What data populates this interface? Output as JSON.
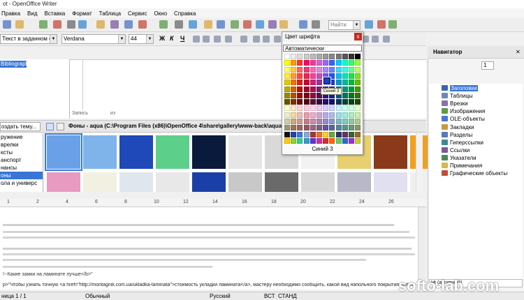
{
  "window": {
    "title": "ot - OpenOffice Writer"
  },
  "menu": [
    {
      "label": "Правка"
    },
    {
      "label": "Вид"
    },
    {
      "label": "Вставка"
    },
    {
      "label": "Формат"
    },
    {
      "label": "Таблица"
    },
    {
      "label": "Сервис"
    },
    {
      "label": "Окно"
    },
    {
      "label": "Справка"
    }
  ],
  "toolbar": {
    "find_placeholder": "Найти"
  },
  "format": {
    "style": "Текст в заданном фо",
    "font": "Verdana",
    "size": "44",
    "bold": "Ж",
    "italic": "К",
    "underline": "Ч"
  },
  "database": {
    "selected": "Bibliography",
    "records_label": "Запись",
    "of_label": "из"
  },
  "gallery": {
    "new_theme_label": "оздать тему...",
    "path_label": "Фоны - aqua (C:\\Program Files (x86)\\OpenOffice 4\\share\\gallery\\www-back\\aqua.jpg)",
    "themes": [
      {
        "label": "ружение"
      },
      {
        "label": "врелки"
      },
      {
        "label": "ксты"
      },
      {
        "label": "анспорт"
      },
      {
        "label": "нансы"
      },
      {
        "label": "оны"
      },
      {
        "label": "ола и универс"
      }
    ]
  },
  "ruler": {
    "ticks": [
      "1",
      "2",
      "4",
      "6",
      "8",
      "10",
      "12",
      "14",
      "16",
      "18",
      "20",
      "22",
      "24",
      "26"
    ]
  },
  "document": {
    "line_tag": "!--Какие замки на ламинате лучше</b>\"",
    "line_main": "р>\"Чтобы узнать точную <a href=\"http://montagnik.com.ua/ukladka-laminata\">стоимость укладки ламината</a>, мастеру необходимо сообщить, какой вид напольного покрытия выбра"
  },
  "color_popup": {
    "title": "Цвет шрифта",
    "close": "x",
    "automatic": "Автоматически",
    "selected_name": "Синий 3",
    "tooltip": "Синий 3"
  },
  "navigator": {
    "title": "Навигатор",
    "page_number": "1",
    "footer": "Ht (активный)",
    "items": [
      {
        "label": "Заголовки",
        "color": "#3c64b4"
      },
      {
        "label": "Таблицы",
        "color": "#6a8bb8"
      },
      {
        "label": "Врезки",
        "color": "#8b6fb0"
      },
      {
        "label": "Изображения",
        "color": "#5a9a4a"
      },
      {
        "label": "OLE-объекты",
        "color": "#4a78c8"
      },
      {
        "label": "Закладки",
        "color": "#c89a3a"
      },
      {
        "label": "Разделы",
        "color": "#5a7ab0"
      },
      {
        "label": "Гиперссылки",
        "color": "#3a8a9a"
      },
      {
        "label": "Ссылки",
        "color": "#7a5aa0"
      },
      {
        "label": "Указатели",
        "color": "#4a8a5a"
      },
      {
        "label": "Примечания",
        "color": "#d4b84a"
      },
      {
        "label": "Графические объекты",
        "color": "#c84a3a"
      }
    ]
  },
  "status": {
    "page": "ница  1 / 1",
    "style": "Обычный",
    "language": "Русский",
    "ins": "ВСТ",
    "mode": "СТАНД"
  },
  "watermark": "softo-lab.com",
  "colors": {
    "accent": "#3875d7",
    "close": "#c42b1c"
  }
}
